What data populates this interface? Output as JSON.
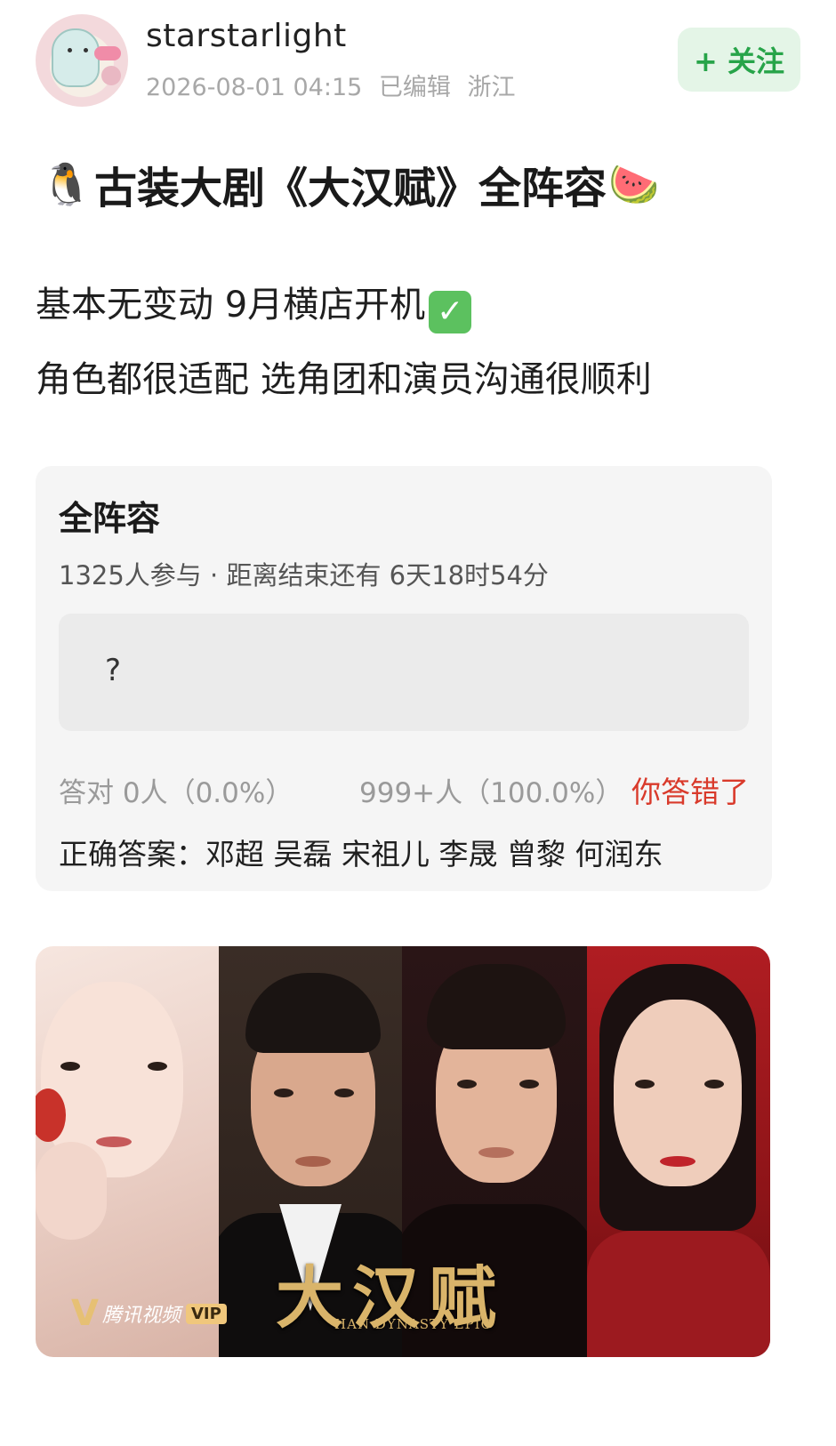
{
  "post": {
    "author": {
      "username": "starstarlight"
    },
    "meta": {
      "datetime": "2026-08-01 04:15",
      "edited": "已编辑",
      "location": "浙江"
    },
    "follow_label": "+ 关注",
    "title": "古装大剧《大汉赋》全阵容",
    "title_emoji_left": "🐧",
    "title_emoji_right": "🍉",
    "body_line_1": "基本无变动 9月横店开机",
    "body_line_1_check": "✓",
    "body_line_2": "角色都很适配 选角团和演员沟通很顺利"
  },
  "quiz": {
    "title": "全阵容",
    "stats": "1325人参与 · 距离结束还有 6天18时54分",
    "my_answer": "?",
    "correct_result": "答对  0人（0.0%）",
    "wrong_result": "999+人（100.0%）",
    "verdict": "你答错了",
    "correct_answer": "正确答案：邓超 吴磊 宋祖儿 李晟 曾黎 何润东"
  },
  "poster": {
    "logo_text": "大汉赋",
    "subtitle": "HAN DYNASTY EPIC",
    "badge_text": "腾讯视频",
    "badge_vip": "VIP",
    "badge_v": "V"
  }
}
